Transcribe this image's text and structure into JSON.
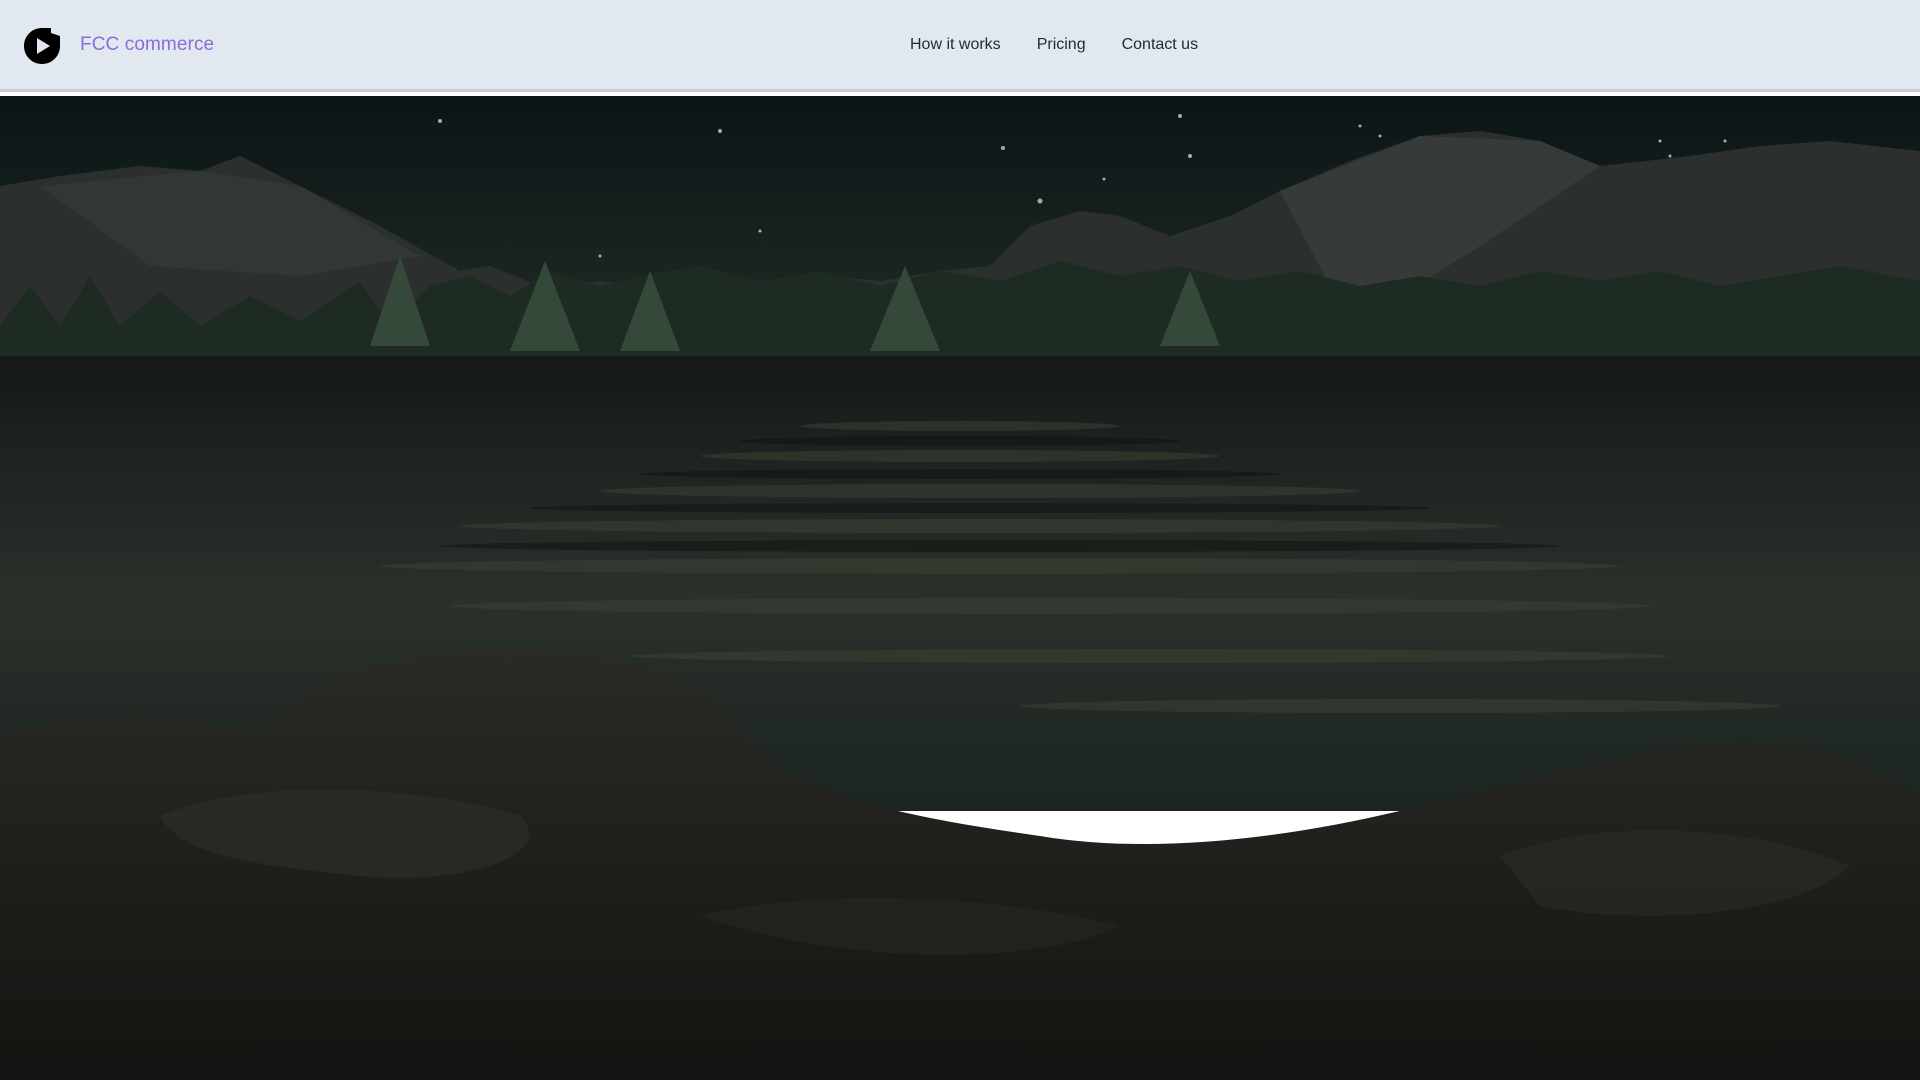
{
  "brand": {
    "name": "FCC commerce",
    "logo_icon": "play-circle-logo-icon",
    "color": "#8b6cd9"
  },
  "nav": {
    "links": [
      {
        "label": "How it works"
      },
      {
        "label": "Pricing"
      },
      {
        "label": "Contact us"
      }
    ]
  },
  "hero": {
    "scene": "night-lake-mountain-landscape",
    "colors": {
      "sky": "#0c1416",
      "horizon_glow": "#2f3a25",
      "water": "#1f2a27",
      "foreground": "#1a1a18"
    }
  }
}
